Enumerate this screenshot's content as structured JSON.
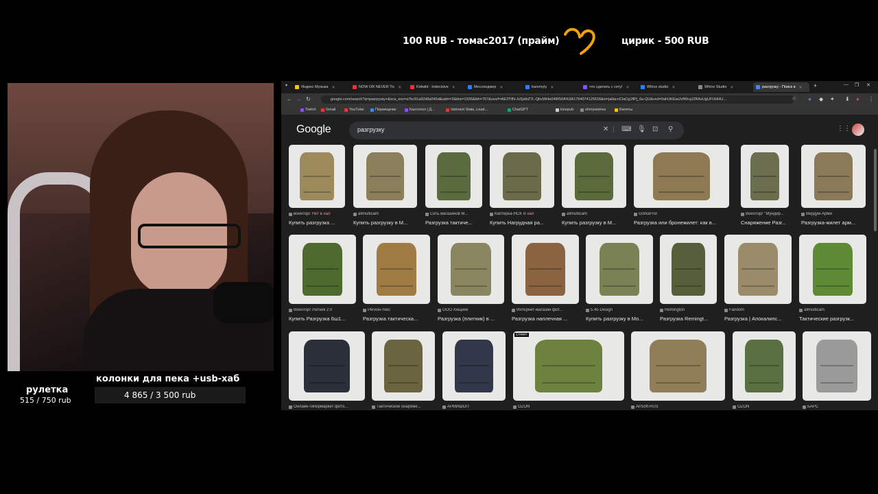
{
  "overlay": {
    "donation_left": "100 RUB - томас2017 (прайм)",
    "donation_right": "цирик - 500 RUB",
    "roulette_title": "рулетка",
    "roulette_value": "515 / 750 rub",
    "goal_title": "колонки для пека +usb-хаб",
    "goal_value": "4 865 / 3 500 rub"
  },
  "browser": {
    "tabs": [
      {
        "label": "Яндекс Музыка",
        "color": "#f7c500"
      },
      {
        "label": "NOW OR NEVER Tic",
        "color": "#e33"
      },
      {
        "label": "Kidwild - Indecisive",
        "color": "#e33"
      },
      {
        "label": "Мессенджер",
        "color": "#2a7fff"
      },
      {
        "label": "karemyty",
        "color": "#2a7fff"
      },
      {
        "label": "что сделать с сету!",
        "color": "#8a4fff"
      },
      {
        "label": "Whice studio",
        "color": "#2a7fff"
      },
      {
        "label": "Whice Studio",
        "color": "#888"
      },
      {
        "label": "разгрузку - Поиск в",
        "color": "#4285f4"
      }
    ],
    "url": "google.com/search?q=разгрузку+&sca_esv=a7bc91a92d9a045d&udm=2&biw=1536&bih=767&sxsrf=AE3TifN-Jc5jvlbZ7L-QbvWi4e04lR50A%3A1764074125618&ei=jallacnCIaCg1flPj_6a-QU&ved=0ahUKEwiJvfWcqJ2RAxUgUFUHHU...",
    "bookmarks": [
      {
        "label": "Twitch",
        "color": "#9146ff"
      },
      {
        "label": "Gmail",
        "color": "#e33"
      },
      {
        "label": "YouTube",
        "color": "#e33"
      },
      {
        "label": "Переводчик",
        "color": "#4285f4"
      },
      {
        "label": "Кантопол | Д...",
        "color": "#8a4fff"
      },
      {
        "label": "Valorant Stats, Lead...",
        "color": "#e33"
      },
      {
        "label": "ChatGPT",
        "color": "#10a37f"
      },
      {
        "label": "kinopub",
        "color": "#ccc"
      },
      {
        "label": "ohmywishes",
        "color": "#888"
      },
      {
        "label": "Билеты",
        "color": "#f7c500"
      }
    ]
  },
  "google": {
    "logo": "Google",
    "query": "разгрузку",
    "results": [
      {
        "src": "военторг",
        "src2": "Нет в нал",
        "title": "Купить разгрузка ...",
        "color": "#9c8a5a"
      },
      {
        "src": "allmulticam",
        "title": "Купить разгрузку в М...",
        "color": "#8a7f5a"
      },
      {
        "src": "Сеть магазинов М...",
        "title": "Разгрузка тактиче...",
        "color": "#5a6b3e"
      },
      {
        "src": "Каптерка-НСК",
        "src2": "В нал",
        "title": "Купить Нагрудная ра...",
        "color": "#6b6b4a"
      },
      {
        "src": "allmulticam",
        "title": "Купить разгрузку в М...",
        "color": "#5b6a3a"
      },
      {
        "src": "GorkaFrol",
        "title": "Разгрузка или бронежилет: как в...",
        "color": "#8e7a52"
      },
      {
        "src": "Военторг \"Мундир...",
        "title": "Снаряжение Разг...",
        "color": "#6a6d4e"
      },
      {
        "src": "Вердум-Арми",
        "title": "Разгрузка-жилет арм...",
        "color": "#8a7a5a"
      },
      {
        "src": "Военторг Ратник 2.0",
        "title": "Купить Разгрузка 6ш1...",
        "color": "#4f6a2e"
      },
      {
        "src": "Регион-текс",
        "title": "Разгрузка тактическа...",
        "color": "#a07c45"
      },
      {
        "src": "ООО Хищник",
        "title": "Разгрузка (плитник) в ...",
        "color": "#8a8660"
      },
      {
        "src": "Интернет-магазин фот...",
        "title": "Разгрузка наплечная ...",
        "color": "#8a6440"
      },
      {
        "src": "5.45 Design",
        "title": "Купить разгрузку в Мо...",
        "color": "#7a8255"
      },
      {
        "src": "Remington",
        "title": "Разгрузка Remingt...",
        "color": "#55603a"
      },
      {
        "src": "Fandom",
        "title": "Разгрузка | Апокалипс...",
        "color": "#9a8c6a"
      },
      {
        "src": "allmulticam",
        "title": "Тактические разгрузк...",
        "color": "#5f8a35"
      },
      {
        "src": "Онлайн-гипермаркет фото...",
        "title": "",
        "color": "#2a2f3a"
      },
      {
        "src": "Тактическое снаряже...",
        "title": "",
        "color": "#6b6440"
      },
      {
        "src": "АРМИШОП",
        "title": "",
        "color": "#33374a"
      },
      {
        "src": "OZON",
        "title": "",
        "color": "#6e8240",
        "tag": "Green"
      },
      {
        "src": "AirSoft-RUS",
        "title": "",
        "color": "#8f7e58"
      },
      {
        "src": "OZON",
        "title": "",
        "color": "#5a7040"
      },
      {
        "src": "БАРС",
        "title": "",
        "color": "#9a9a9a"
      }
    ]
  }
}
